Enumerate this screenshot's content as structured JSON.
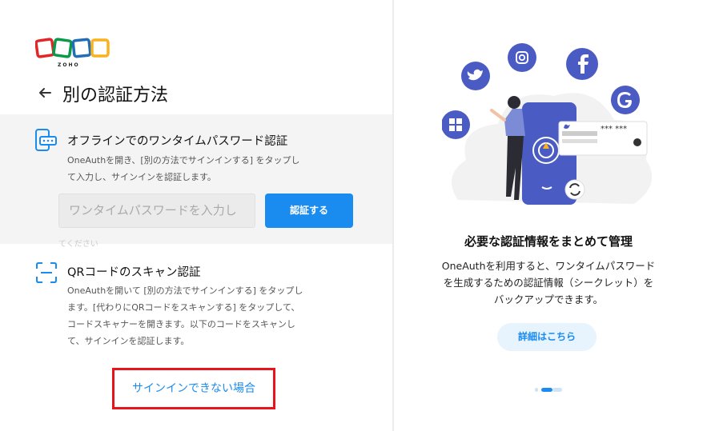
{
  "brand": {
    "name": "ZOHO"
  },
  "header": {
    "title": "別の認証方法"
  },
  "offline_otp": {
    "title": "オフラインでのワンタイムパスワード認証",
    "desc_line1": "OneAuthを開き、[別の方法でサインインする] をタップし",
    "desc_line2": "て入力し、サインインを認証します。",
    "input_placeholder": "ワンタイムパスワードを入力し",
    "verify_label": "認証する",
    "hidden_text": "てください"
  },
  "qr_scan": {
    "title": "QRコードのスキャン認証",
    "desc_line1": "OneAuthを開いて [別の方法でサインインする] をタップし",
    "desc_line2": "ます。[代わりにQRコードをスキャンする] をタップして、",
    "desc_line3": "コードスキャナーを開きます。以下のコードをスキャンし",
    "desc_line4": "て、サインインを認証します。"
  },
  "links": {
    "cant_sign_in": "サインインできない場合"
  },
  "promo": {
    "title": "必要な認証情報をまとめて管理",
    "desc_line1": "OneAuthを利用すると、ワンタイムパスワード",
    "desc_line2": "を生成するための認証情報（シークレット）を",
    "desc_line3": "バックアップできます。",
    "more_label": "詳細はこちら",
    "card_mask": "*** ***",
    "carousel_active": 2,
    "carousel_count": 3
  },
  "colors": {
    "accent": "#1a8cf0",
    "highlight": "#e8141c",
    "illustration": "#4a5bc4"
  }
}
